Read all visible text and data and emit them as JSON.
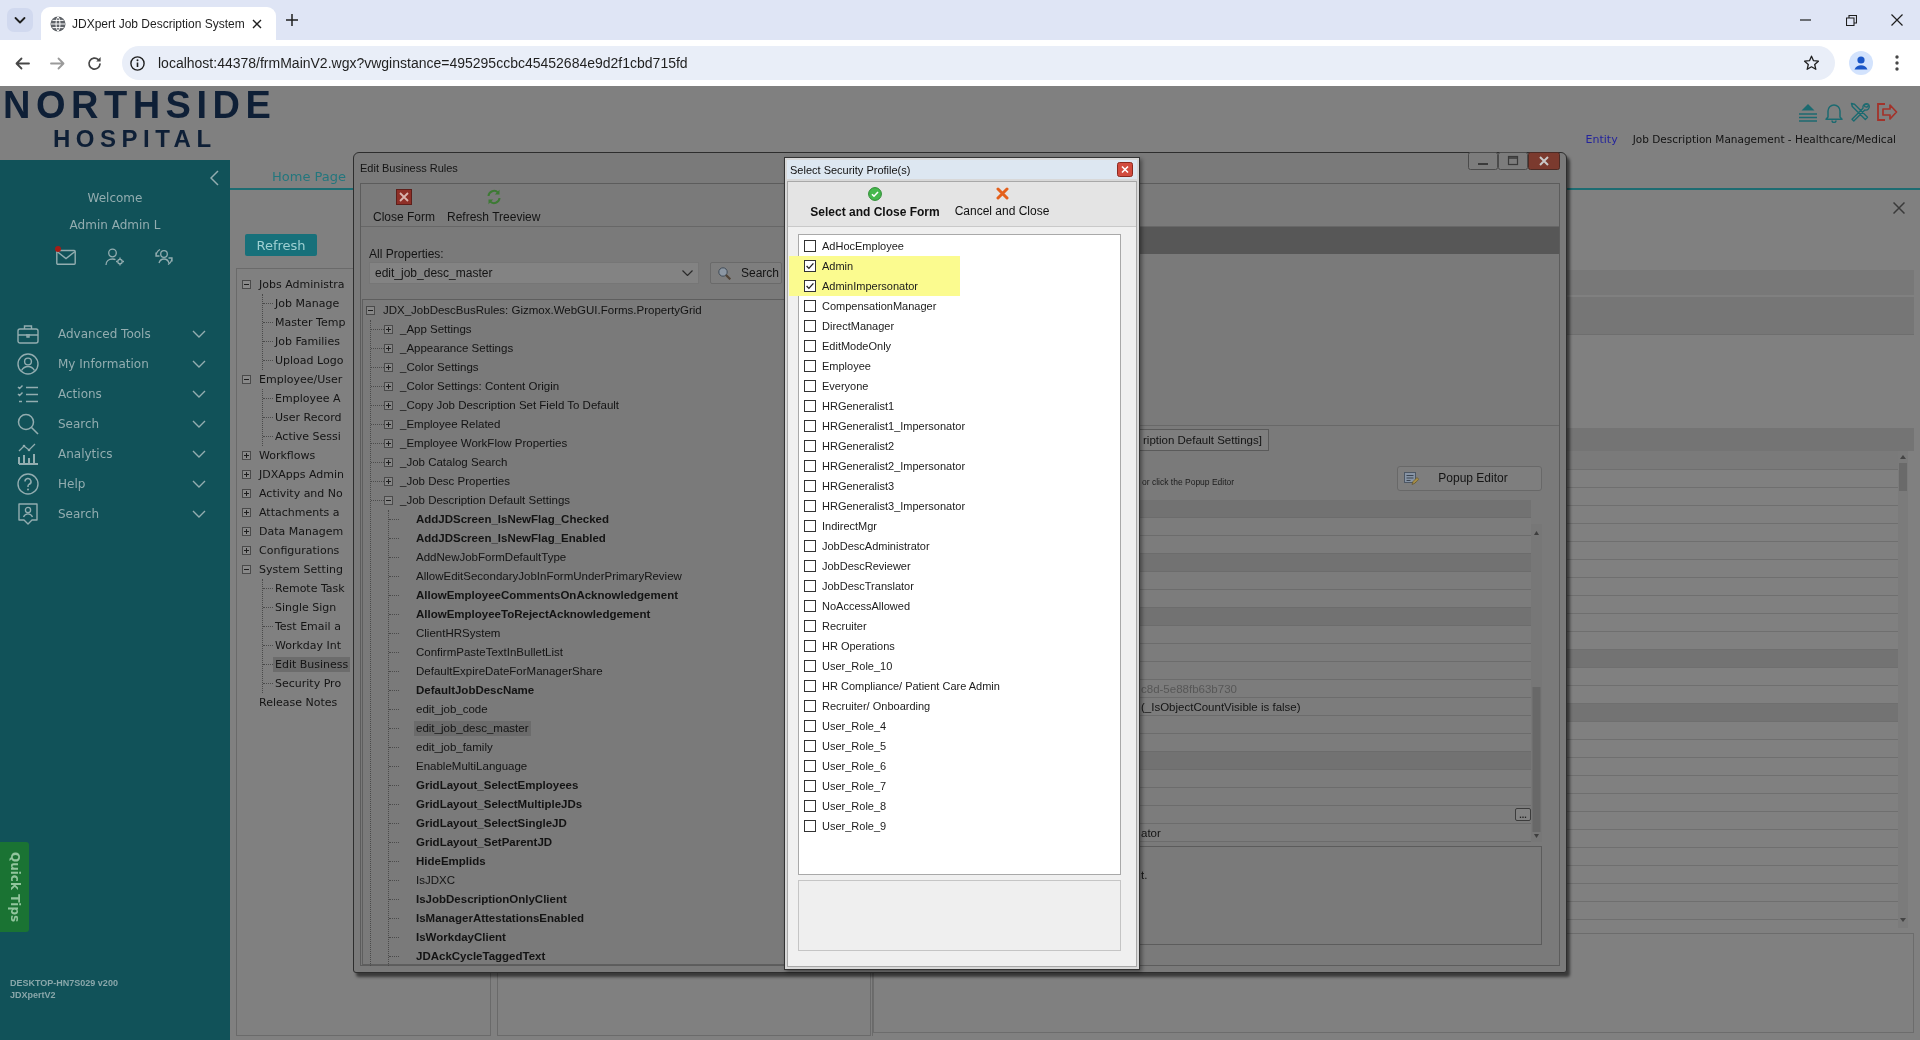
{
  "browser": {
    "tab_title": "JDXpert Job Description System",
    "url": "localhost:44378/frmMainV2.wgx?vwginstance=495295ccbc45452684e9d2f1cbd715fd"
  },
  "header": {
    "logo": {
      "line_1": "NORTHSIDE",
      "line_2": "HOSPITAL"
    },
    "entity_link": "Entity",
    "app_name": "Job Description Management - Healthcare/Medical"
  },
  "sidebar": {
    "welcome": "Welcome",
    "user_name": "Admin Admin L",
    "mail_unread": true,
    "menu": [
      {
        "label": "Advanced Tools",
        "expanded": false
      },
      {
        "label": "My Information",
        "expanded": false
      },
      {
        "label": "Actions",
        "expanded": false
      },
      {
        "label": "Search",
        "expanded": false
      },
      {
        "label": "Analytics",
        "expanded": false
      },
      {
        "label": "Help",
        "expanded": false
      },
      {
        "label": "Search",
        "expanded": false
      }
    ],
    "quick_tips": "Quick Tips",
    "footer": [
      "DESKTOP-HN7S029 v200",
      "JDXpertV2"
    ]
  },
  "main": {
    "tabs": [
      {
        "label": "Home Page",
        "selected": true
      }
    ],
    "refresh_button": "Refresh",
    "nav_tree": [
      {
        "label": "Jobs Administra",
        "expanded": true,
        "selected": false,
        "children": [
          {
            "label": "Job Manage",
            "selected": false
          },
          {
            "label": "Master Temp",
            "selected": false
          },
          {
            "label": "Job Families",
            "selected": false
          },
          {
            "label": "Upload Logo",
            "selected": false
          }
        ]
      },
      {
        "label": "Employee/User",
        "expanded": true,
        "selected": false,
        "children": [
          {
            "label": "Employee A",
            "selected": false
          },
          {
            "label": "User Record",
            "selected": false
          },
          {
            "label": "Active Sessi",
            "selected": false
          }
        ]
      },
      {
        "label": "Workflows",
        "expanded": false,
        "selected": false
      },
      {
        "label": "JDXApps Admin",
        "expanded": false,
        "selected": false
      },
      {
        "label": "Activity and No",
        "expanded": false,
        "selected": false
      },
      {
        "label": "Attachments a",
        "expanded": false,
        "selected": false
      },
      {
        "label": "Data Managem",
        "expanded": false,
        "selected": false
      },
      {
        "label": "Configurations",
        "expanded": false,
        "selected": false
      },
      {
        "label": "System Setting",
        "expanded": true,
        "selected": false,
        "children": [
          {
            "label": "Remote Task",
            "selected": false
          },
          {
            "label": "Single Sign",
            "selected": false
          },
          {
            "label": "Test Email a",
            "selected": false
          },
          {
            "label": "Workday Int",
            "selected": false
          },
          {
            "label": "Edit Business",
            "selected": true
          },
          {
            "label": "Security Pro",
            "selected": false
          }
        ]
      },
      {
        "label": "Release Notes",
        "selected": false
      }
    ],
    "list_rows": [
      {
        "kind": "row"
      },
      {
        "kind": "row"
      },
      {
        "kind": "row"
      },
      {
        "kind": "row"
      },
      {
        "kind": "row"
      },
      {
        "kind": "row"
      },
      {
        "kind": "row"
      },
      {
        "kind": "row"
      },
      {
        "kind": "row"
      },
      {
        "kind": "row"
      },
      {
        "kind": "band"
      },
      {
        "kind": "row"
      },
      {
        "kind": "row"
      },
      {
        "kind": "band"
      },
      {
        "kind": "row"
      },
      {
        "kind": "row"
      },
      {
        "kind": "row"
      },
      {
        "kind": "row"
      },
      {
        "kind": "row"
      },
      {
        "kind": "row"
      },
      {
        "kind": "row"
      },
      {
        "kind": "row"
      },
      {
        "kind": "row"
      },
      {
        "kind": "row"
      },
      {
        "kind": "row"
      }
    ]
  },
  "business_rules_window": {
    "title": "Edit Business Rules",
    "toolbar": [
      {
        "label": "Close Form",
        "kind": "close"
      },
      {
        "label": "Refresh Treeview",
        "kind": "refresh"
      }
    ],
    "properties_label": "All Properties:",
    "properties_value": "edit_job_desc_master",
    "search_button": "Search",
    "property_tree": {
      "label": "JDX_JobDescBusRules: Gizmox.WebGUI.Forms.PropertyGrid",
      "expanded": true,
      "selected": false,
      "children": [
        {
          "label": "_App Settings",
          "expanded": false,
          "selected": false
        },
        {
          "label": "_Appearance Settings",
          "expanded": false,
          "selected": false
        },
        {
          "label": "_Color Settings",
          "expanded": false,
          "selected": false
        },
        {
          "label": "_Color Settings: Content Origin",
          "expanded": false,
          "selected": false
        },
        {
          "label": "_Copy Job Description Set Field To Default",
          "expanded": false,
          "selected": false
        },
        {
          "label": "_Employee Related",
          "expanded": false,
          "selected": false
        },
        {
          "label": "_Employee WorkFlow Properties",
          "expanded": false,
          "selected": false
        },
        {
          "label": "_Job Catalog Search",
          "expanded": false,
          "selected": false
        },
        {
          "label": "_Job Desc Properties",
          "expanded": false,
          "selected": false
        },
        {
          "label": "_Job Description Default Settings",
          "expanded": true,
          "selected": false,
          "children": [
            {
              "label": "AddJDScreen_IsNewFlag_Checked",
              "modified": true,
              "selected": false
            },
            {
              "label": "AddJDScreen_IsNewFlag_Enabled",
              "modified": true,
              "selected": false
            },
            {
              "label": "AddNewJobFormDefaultType",
              "modified": false,
              "selected": false
            },
            {
              "label": "AllowEditSecondaryJobInFormUnderPrimaryReview",
              "modified": false,
              "selected": false
            },
            {
              "label": "AllowEmployeeCommentsOnAcknowledgement",
              "modified": true,
              "selected": false
            },
            {
              "label": "AllowEmployeeToRejectAcknowledgement",
              "modified": true,
              "selected": false
            },
            {
              "label": "ClientHRSystem",
              "modified": false,
              "selected": false
            },
            {
              "label": "ConfirmPasteTextInBulletList",
              "modified": false,
              "selected": false
            },
            {
              "label": "DefaultExpireDateForManagerShare",
              "modified": false,
              "selected": false
            },
            {
              "label": "DefaultJobDescName",
              "modified": true,
              "selected": false
            },
            {
              "label": "edit_job_code",
              "modified": false,
              "selected": false
            },
            {
              "label": "edit_job_desc_master",
              "modified": false,
              "selected": true
            },
            {
              "label": "edit_job_family",
              "modified": false,
              "selected": false
            },
            {
              "label": "EnableMultiLanguage",
              "modified": false,
              "selected": false
            },
            {
              "label": "GridLayout_SelectEmployees",
              "modified": true,
              "selected": false
            },
            {
              "label": "GridLayout_SelectMultipleJDs",
              "modified": true,
              "selected": false
            },
            {
              "label": "GridLayout_SelectSingleJD",
              "modified": true,
              "selected": false
            },
            {
              "label": "GridLayout_SetParentJD",
              "modified": true,
              "selected": false
            },
            {
              "label": "HideEmplids",
              "modified": true,
              "selected": false
            },
            {
              "label": "IsJDXC",
              "modified": false,
              "selected": false
            },
            {
              "label": "IsJobDescriptionOnlyClient",
              "modified": true,
              "selected": false
            },
            {
              "label": "IsManagerAttestationsEnabled",
              "modified": true,
              "selected": false
            },
            {
              "label": "IsWorkdayClient",
              "modified": true,
              "selected": false
            },
            {
              "label": "JDAckCycleTaggedText",
              "modified": true,
              "selected": false
            }
          ]
        }
      ]
    },
    "category_tab": "ription Default Settings]",
    "editor_hint": "or click the Popup Editor",
    "popup_editor_button": "Popup Editor",
    "grid_rows": [
      {
        "kind": "category"
      },
      {
        "kind": "property"
      },
      {
        "kind": "property"
      },
      {
        "kind": "category"
      },
      {
        "kind": "property"
      },
      {
        "kind": "property"
      },
      {
        "kind": "category"
      },
      {
        "kind": "property"
      },
      {
        "kind": "property"
      },
      {
        "kind": "property"
      },
      {
        "kind": "property",
        "value": "c8d-5e88fb63b730",
        "readonly": true
      },
      {
        "kind": "property",
        "value": "(_IsObjectCountVisible is false)",
        "readonly": false
      },
      {
        "kind": "property"
      },
      {
        "kind": "property"
      },
      {
        "kind": "category"
      },
      {
        "kind": "property"
      },
      {
        "kind": "property"
      },
      {
        "kind": "property",
        "button": "..."
      },
      {
        "kind": "property",
        "value": "ator",
        "readonly": false
      }
    ],
    "description": "t."
  },
  "security_profile_dialog": {
    "title": "Select Security Profile(s)",
    "actions": [
      {
        "label": "Select and Close Form",
        "kind": "confirm"
      },
      {
        "label": "Cancel and Close",
        "kind": "cancel"
      }
    ],
    "profiles": [
      {
        "label": "AdHocEmployee",
        "checked": false,
        "highlighted": false
      },
      {
        "label": "Admin",
        "checked": true,
        "highlighted": true
      },
      {
        "label": "AdminImpersonator",
        "checked": true,
        "highlighted": true
      },
      {
        "label": "CompensationManager",
        "checked": false,
        "highlighted": false
      },
      {
        "label": "DirectManager",
        "checked": false,
        "highlighted": false
      },
      {
        "label": "EditModeOnly",
        "checked": false,
        "highlighted": false
      },
      {
        "label": "Employee",
        "checked": false,
        "highlighted": false
      },
      {
        "label": "Everyone",
        "checked": false,
        "highlighted": false
      },
      {
        "label": "HRGeneralist1",
        "checked": false,
        "highlighted": false
      },
      {
        "label": "HRGeneralist1_Impersonator",
        "checked": false,
        "highlighted": false
      },
      {
        "label": "HRGeneralist2",
        "checked": false,
        "highlighted": false
      },
      {
        "label": "HRGeneralist2_Impersonator",
        "checked": false,
        "highlighted": false
      },
      {
        "label": "HRGeneralist3",
        "checked": false,
        "highlighted": false
      },
      {
        "label": "HRGeneralist3_Impersonator",
        "checked": false,
        "highlighted": false
      },
      {
        "label": "IndirectMgr",
        "checked": false,
        "highlighted": false
      },
      {
        "label": "JobDescAdministrator",
        "checked": false,
        "highlighted": false
      },
      {
        "label": "JobDescReviewer",
        "checked": false,
        "highlighted": false
      },
      {
        "label": "JobDescTranslator",
        "checked": false,
        "highlighted": false
      },
      {
        "label": "NoAccessAllowed",
        "checked": false,
        "highlighted": false
      },
      {
        "label": "Recruiter",
        "checked": false,
        "highlighted": false
      },
      {
        "label": "HR Operations",
        "checked": false,
        "highlighted": false
      },
      {
        "label": "User_Role_10",
        "checked": false,
        "highlighted": false
      },
      {
        "label": "HR Compliance/ Patient Care Admin",
        "checked": false,
        "highlighted": false
      },
      {
        "label": "Recruiter/ Onboarding",
        "checked": false,
        "highlighted": false
      },
      {
        "label": "User_Role_4",
        "checked": false,
        "highlighted": false
      },
      {
        "label": "User_Role_5",
        "checked": false,
        "highlighted": false
      },
      {
        "label": "User_Role_6",
        "checked": false,
        "highlighted": false
      },
      {
        "label": "User_Role_7",
        "checked": false,
        "highlighted": false
      },
      {
        "label": "User_Role_8",
        "checked": false,
        "highlighted": false
      },
      {
        "label": "User_Role_9",
        "checked": false,
        "highlighted": false
      }
    ]
  }
}
